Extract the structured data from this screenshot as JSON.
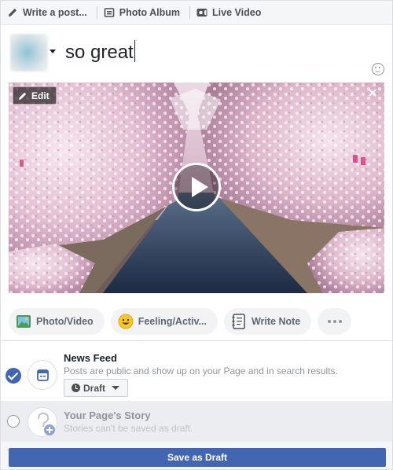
{
  "tabs": [
    {
      "label": "Write a post...",
      "icon": "pencil-icon"
    },
    {
      "label": "Photo Album",
      "icon": "photo-album-icon"
    },
    {
      "label": "Live Video",
      "icon": "live-video-icon"
    }
  ],
  "composer": {
    "text": "so great",
    "emoji_icon": "smiley-icon"
  },
  "media": {
    "edit_label": "Edit",
    "type": "video",
    "play_icon": "play-icon"
  },
  "actions": [
    {
      "label": "Photo/Video",
      "icon": "photo-video-icon"
    },
    {
      "label": "Feeling/Activ...",
      "icon": "feeling-emoji-icon"
    },
    {
      "label": "Write Note",
      "icon": "note-icon"
    }
  ],
  "share": {
    "newsfeed": {
      "title": "News Feed",
      "description": "Posts are public and show up on your Page and in search results.",
      "selected": true,
      "schedule": "Draft"
    },
    "story": {
      "title": "Your Page's Story",
      "description": "Stories can't be saved as draft.",
      "selected": false
    }
  },
  "save_button": "Save as Draft",
  "colors": {
    "primary": "#4267b2",
    "tab_bg": "#f5f6f7",
    "muted_text": "#90949c"
  }
}
